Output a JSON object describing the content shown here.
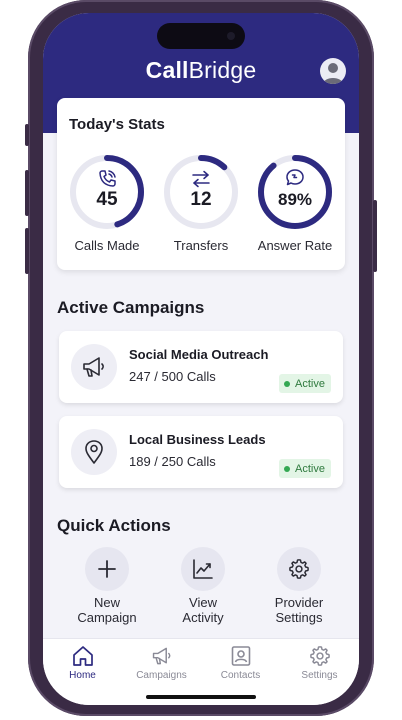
{
  "app": {
    "brand_bold": "Call",
    "brand_rest": "Bridge"
  },
  "stats": {
    "title": "Today's Stats",
    "items": [
      {
        "value": "45",
        "label": "Calls Made",
        "icon": "phone-icon",
        "progress": 0.45
      },
      {
        "value": "12",
        "label": "Transfers",
        "icon": "transfer-arrows-icon",
        "progress": 0.12
      },
      {
        "value": "89%",
        "label": "Answer Rate",
        "icon": "chat-bubble-icon",
        "progress": 0.89
      }
    ]
  },
  "campaigns": {
    "title": "Active Campaigns",
    "items": [
      {
        "name": "Social Media Outreach",
        "count": "247 / 500 Calls",
        "status": "Active",
        "icon": "megaphone-icon"
      },
      {
        "name": "Local Business Leads",
        "count": "189 / 250 Calls",
        "status": "Active",
        "icon": "location-pin-icon"
      }
    ]
  },
  "quick_actions": {
    "title": "Quick Actions",
    "items": [
      {
        "line1": "New",
        "line2": "Campaign",
        "icon": "plus-icon"
      },
      {
        "line1": "View",
        "line2": "Activity",
        "icon": "chart-icon"
      },
      {
        "line1": "Provider",
        "line2": "Settings",
        "icon": "gear-icon"
      }
    ]
  },
  "tabs": [
    {
      "label": "Home",
      "icon": "home-icon",
      "active": true
    },
    {
      "label": "Campaigns",
      "icon": "megaphone-icon",
      "active": false
    },
    {
      "label": "Contacts",
      "icon": "contact-card-icon",
      "active": false
    },
    {
      "label": "Settings",
      "icon": "gear-icon",
      "active": false
    }
  ],
  "colors": {
    "primary": "#2d2a80",
    "ring_track": "#e7e7f0",
    "active_green": "#34a853"
  }
}
